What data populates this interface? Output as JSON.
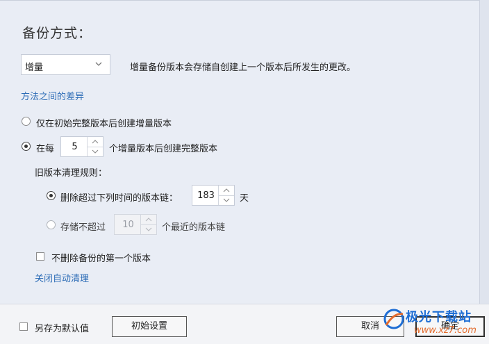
{
  "title": "备份方式：",
  "method": {
    "selected": "增量",
    "description": "增量备份版本会存储自创建上一个版本后所发生的更改。",
    "diff_link": "方法之间的差异"
  },
  "options": {
    "opt1_label": "仅在初始完整版本后创建增量版本",
    "opt2_prefix": "在每",
    "opt2_value": "5",
    "opt2_suffix": "个增量版本后创建完整版本"
  },
  "cleanup": {
    "heading": "旧版本清理规则：",
    "rule1_label": "删除超过下列时间的版本链：",
    "rule1_value": "183",
    "rule1_unit": "天",
    "rule2_prefix": "存储不超过",
    "rule2_value": "10",
    "rule2_suffix": "个最近的版本链",
    "keep_first_label": "不删除备份的第一个版本",
    "disable_link": "关闭自动清理"
  },
  "footer": {
    "save_default_label": "另存为默认值",
    "initial_settings": "初始设置",
    "cancel": "取消",
    "ok": "确定"
  },
  "watermark": {
    "brand": "极光下载站",
    "url": "www.xz7.com"
  }
}
